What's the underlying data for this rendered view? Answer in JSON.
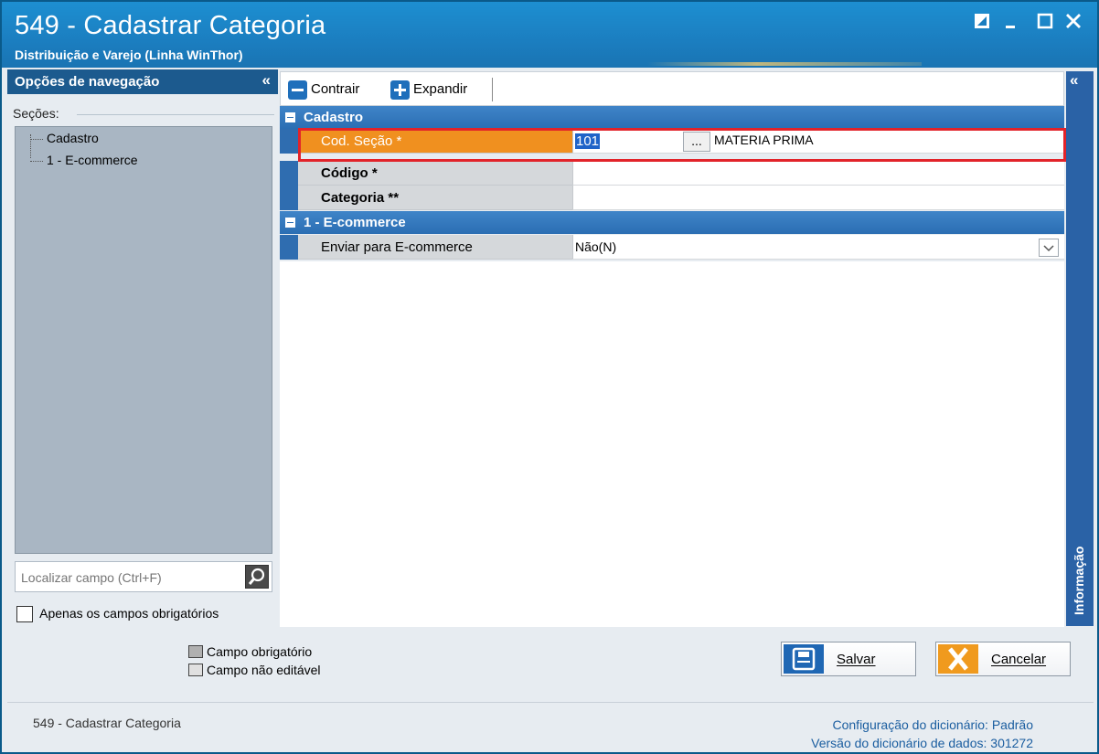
{
  "window": {
    "title": "549 - Cadastrar Categoria",
    "subtitle": "Distribuição e Varejo (Linha WinThor)"
  },
  "nav": {
    "header": "Opções de navegação",
    "collapse_glyph": "«",
    "sections_label": "Seções:",
    "tree": [
      {
        "label": "Cadastro"
      },
      {
        "label": "1 - E-commerce"
      }
    ],
    "search_placeholder": "Localizar campo (Ctrl+F)",
    "required_only_label": "Apenas os campos obrigatórios",
    "required_only_checked": false
  },
  "legend": {
    "required": "Campo obrigatório",
    "not_editable": "Campo não editável",
    "required_color": "#b0b0b0",
    "not_editable_color": "#e0e0e0"
  },
  "toolbar": {
    "contrair": "Contrair",
    "expandir": "Expandir"
  },
  "grid": {
    "cadastro": {
      "label": "Cadastro",
      "fields": {
        "cod_secao": {
          "label": "Cod. Seção *",
          "value": "101",
          "description": "MATERIA PRIMA",
          "button": "..."
        },
        "codigo": {
          "label": "Código *",
          "value": ""
        },
        "categoria": {
          "label": "Categoria **",
          "value": ""
        }
      }
    },
    "ecommerce": {
      "label": "1 - E-commerce",
      "fields": {
        "enviar": {
          "label": "Enviar para E-commerce",
          "value": "Não(N)"
        }
      }
    }
  },
  "info_panel": {
    "label": "Informação",
    "collapse_glyph": "«"
  },
  "actions": {
    "salvar": "Salvar",
    "cancelar": "Cancelar"
  },
  "footer": {
    "left": "549 - Cadastrar Categoria",
    "config_label": "Configuração do dicionário:",
    "config_value": "Padrão",
    "version_label": "Versão do dicionário de dados:",
    "version_value": "301272"
  },
  "colors": {
    "titlebar": "#1b7ec0",
    "nav_header": "#1c5a8e",
    "category_row": "#2b6eb3",
    "active_field": "#f0901f",
    "highlight": "#e2232a"
  }
}
